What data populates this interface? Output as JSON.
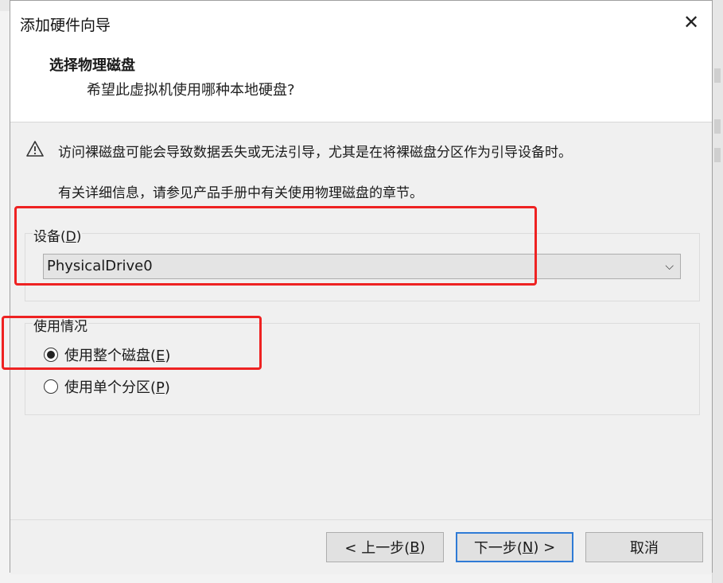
{
  "window": {
    "title": "添加硬件向导",
    "close_glyph": "✕"
  },
  "header": {
    "title": "选择物理磁盘",
    "subtitle": "希望此虚拟机使用哪种本地硬盘?"
  },
  "warning": {
    "icon": "warning-triangle-icon",
    "text": "访问裸磁盘可能会导致数据丢失或无法引导，尤其是在将裸磁盘分区作为引导设备时。",
    "info": "有关详细信息，请参见产品手册中有关使用物理磁盘的章节。"
  },
  "device": {
    "label_prefix": "设备(",
    "label_key": "D",
    "label_suffix": ")",
    "selected": "PhysicalDrive0",
    "chevron_glyph": "⌵"
  },
  "usage": {
    "label": "使用情况",
    "options": [
      {
        "prefix": "使用整个磁盘(",
        "key": "E",
        "suffix": ")",
        "selected": true
      },
      {
        "prefix": "使用单个分区(",
        "key": "P",
        "suffix": ")",
        "selected": false
      }
    ]
  },
  "buttons": {
    "back": {
      "prefix": "< 上一步(",
      "key": "B",
      "suffix": ")"
    },
    "next": {
      "prefix": "下一步(",
      "key": "N",
      "suffix": ") >"
    },
    "cancel": "取消"
  },
  "colors": {
    "annotation": "#ee2222",
    "primary_border": "#2f7bd6"
  }
}
